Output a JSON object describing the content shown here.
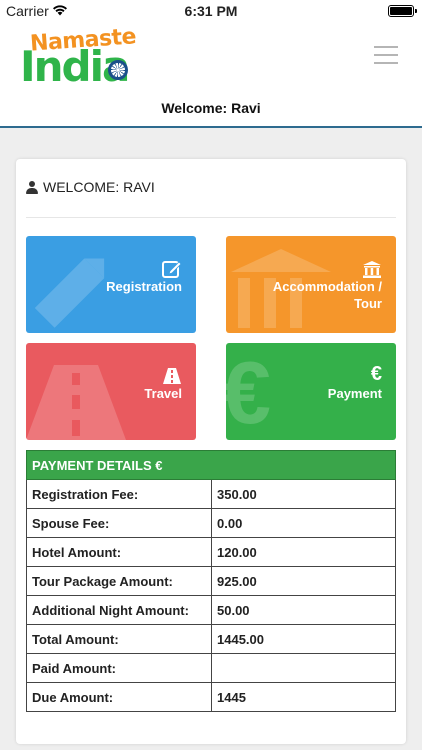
{
  "status_bar": {
    "carrier": "Carrier",
    "time": "6:31 PM"
  },
  "header": {
    "logo_top": "Namaste",
    "logo_bottom": "India",
    "welcome": "Welcome: Ravi"
  },
  "card": {
    "heading": "WELCOME: RAVI",
    "tiles": [
      {
        "label": "Registration",
        "icon": "edit-icon",
        "color": "#3a9ee3"
      },
      {
        "label": "Accommodation / Tour",
        "icon": "bank-icon",
        "color": "#f5962b"
      },
      {
        "label": "Travel",
        "icon": "road-icon",
        "color": "#e95a5f"
      },
      {
        "label": "Payment",
        "icon": "euro-icon",
        "color": "#34b04a"
      }
    ]
  },
  "payment_details": {
    "title": "PAYMENT DETAILS €",
    "rows": [
      {
        "label": "Registration Fee:",
        "value": "350.00"
      },
      {
        "label": "Spouse Fee:",
        "value": "0.00"
      },
      {
        "label": "Hotel Amount:",
        "value": "120.00"
      },
      {
        "label": "Tour Package Amount:",
        "value": "925.00"
      },
      {
        "label": "Additional Night Amount:",
        "value": "50.00"
      },
      {
        "label": "Total Amount:",
        "value": "1445.00"
      },
      {
        "label": "Paid Amount:",
        "value": ""
      },
      {
        "label": "Due Amount:",
        "value": "1445"
      }
    ]
  }
}
